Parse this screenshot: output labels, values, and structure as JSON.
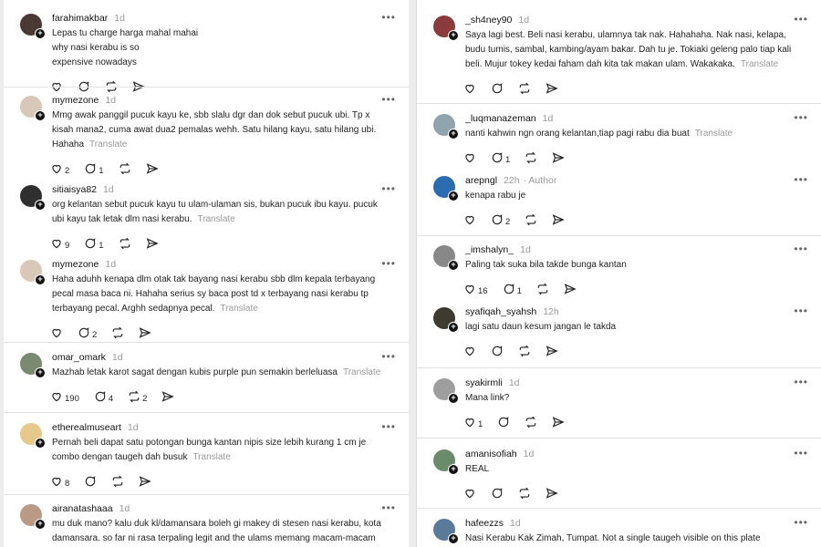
{
  "left": [
    {
      "user": "farahimakbar",
      "time": "1d",
      "lines": [
        "Lepas tu charge harga mahal mahai",
        "why nasi kerabu is so",
        "expensive nowadays"
      ],
      "likes": "",
      "replies": "",
      "reposts": "",
      "translate": ""
    },
    {
      "user": "mymezone",
      "time": "1d",
      "lines": [
        "Mmg awak panggil pucuk kayu ke, sbb slalu dgr dan dok sebut pucuk ubi. Tp x",
        "kisah mana2, cuma awat dua2 pemalas wehh. Satu hilang kayu, satu hilang ubi.",
        "Hahaha"
      ],
      "likes": "2",
      "replies": "1",
      "reposts": "",
      "translate": "Translate"
    },
    {
      "user": "sitiaisya82",
      "time": "1d",
      "lines": [
        "org kelantan sebut pucuk kayu tu ulam-ulaman sis, bukan pucuk ibu kayu. pucuk",
        "ubi kayu tak letak dlm nasi kerabu."
      ],
      "likes": "9",
      "replies": "1",
      "reposts": "",
      "translate": "Translate"
    },
    {
      "user": "mymezone",
      "time": "1d",
      "lines": [
        "Haha aduhh kenapa dlm otak tak bayang nasi kerabu sbb dlm kepala terbayang",
        "pecal masa baca ni. Hahaha serius sy baca post td x terbayang nasi kerabu tp",
        "terbayang pecal. Arghh sedapnya pecal."
      ],
      "likes": "",
      "replies": "2",
      "reposts": "",
      "translate": "Translate"
    },
    {
      "user": "omar_omark",
      "time": "1d",
      "lines": [
        "Mazhab letak karot sagat dengan kubis purple pun semakin berleluasa"
      ],
      "likes": "190",
      "replies": "4",
      "reposts": "2",
      "translate": "Translate"
    },
    {
      "user": "etherealmuseart",
      "time": "1d",
      "lines": [
        "Pernah beli dapat satu potongan bunga kantan nipis size lebih kurang 1 cm je",
        "combo dengan taugeh dah busuk"
      ],
      "likes": "8",
      "replies": "",
      "reposts": "",
      "translate": "Translate"
    },
    {
      "user": "airanatashaaa",
      "time": "1d",
      "lines": [
        "mu duk mano? kalu duk kl/damansara boleh gi makey di stesen nasi kerabu, kota",
        "damansara. so far ni rasa terpaling legit and the ulams memang macam-macam"
      ],
      "likes": "",
      "replies": "",
      "reposts": "",
      "translate": ""
    }
  ],
  "right": [
    {
      "user": "_sh4ney90",
      "time": "1d",
      "author": "",
      "lines": [
        "Saya lagi best. Beli nasi kerabu, ulamnya tak nak. Hahahaha. Nak nasi, kelapa,",
        "budu tumis, sambal, kambing/ayam bakar. Dah tu je. Tokiaki geleng palo tiap kali",
        "beli. Mujur tokey kedai faham dah kita tak makan ulam. Wakakaka."
      ],
      "likes": "",
      "replies": "",
      "reposts": "",
      "translate": "Translate"
    },
    {
      "user": "_luqmanazeman",
      "time": "1d",
      "author": "",
      "lines": [
        "nanti kahwin ngn orang kelantan,tiap pagi rabu dia buat"
      ],
      "likes": "",
      "replies": "1",
      "reposts": "",
      "translate": "Translate"
    },
    {
      "user": "arepngl",
      "time": "22h",
      "author": "Author",
      "lines": [
        "kenapa rabu je"
      ],
      "likes": "",
      "replies": "2",
      "reposts": "",
      "translate": ""
    },
    {
      "user": "_imshalyn_",
      "time": "1d",
      "author": "",
      "lines": [
        "Paling tak suka bila takde bunga kantan"
      ],
      "likes": "16",
      "replies": "1",
      "reposts": "",
      "translate": ""
    },
    {
      "user": "syafiqah_syahsh",
      "time": "12h",
      "author": "",
      "lines": [
        "lagi satu daun kesum jangan le takda"
      ],
      "likes": "",
      "replies": "",
      "reposts": "",
      "translate": ""
    },
    {
      "user": "syakirmli",
      "time": "1d",
      "author": "",
      "lines": [
        "Mana link?"
      ],
      "likes": "1",
      "replies": "",
      "reposts": "",
      "translate": ""
    },
    {
      "user": "amanisofiah",
      "time": "1d",
      "author": "",
      "lines": [
        "REAL"
      ],
      "likes": "",
      "replies": "",
      "reposts": "",
      "translate": ""
    },
    {
      "user": "hafeezzs",
      "time": "1d",
      "author": "",
      "lines": [
        "Nasi Kerabu Kak Zimah, Tumpat. Not a single taugeh visible on this plate"
      ],
      "likes": "",
      "replies": "",
      "reposts": "",
      "translate": ""
    }
  ],
  "more_label": "•••",
  "colors": {
    "avatar": [
      "#4a3a35",
      "#d9c7b8",
      "#2f2f2f",
      "#d9c7b8",
      "#7a8a70",
      "#e6c98a",
      "#b89a86",
      "#8a3b3b",
      "#90a4ae",
      "#2b6cb0",
      "#888888",
      "#3d3a30",
      "#9e9e9e",
      "#6b8c6b",
      "#5a7a9a"
    ]
  }
}
